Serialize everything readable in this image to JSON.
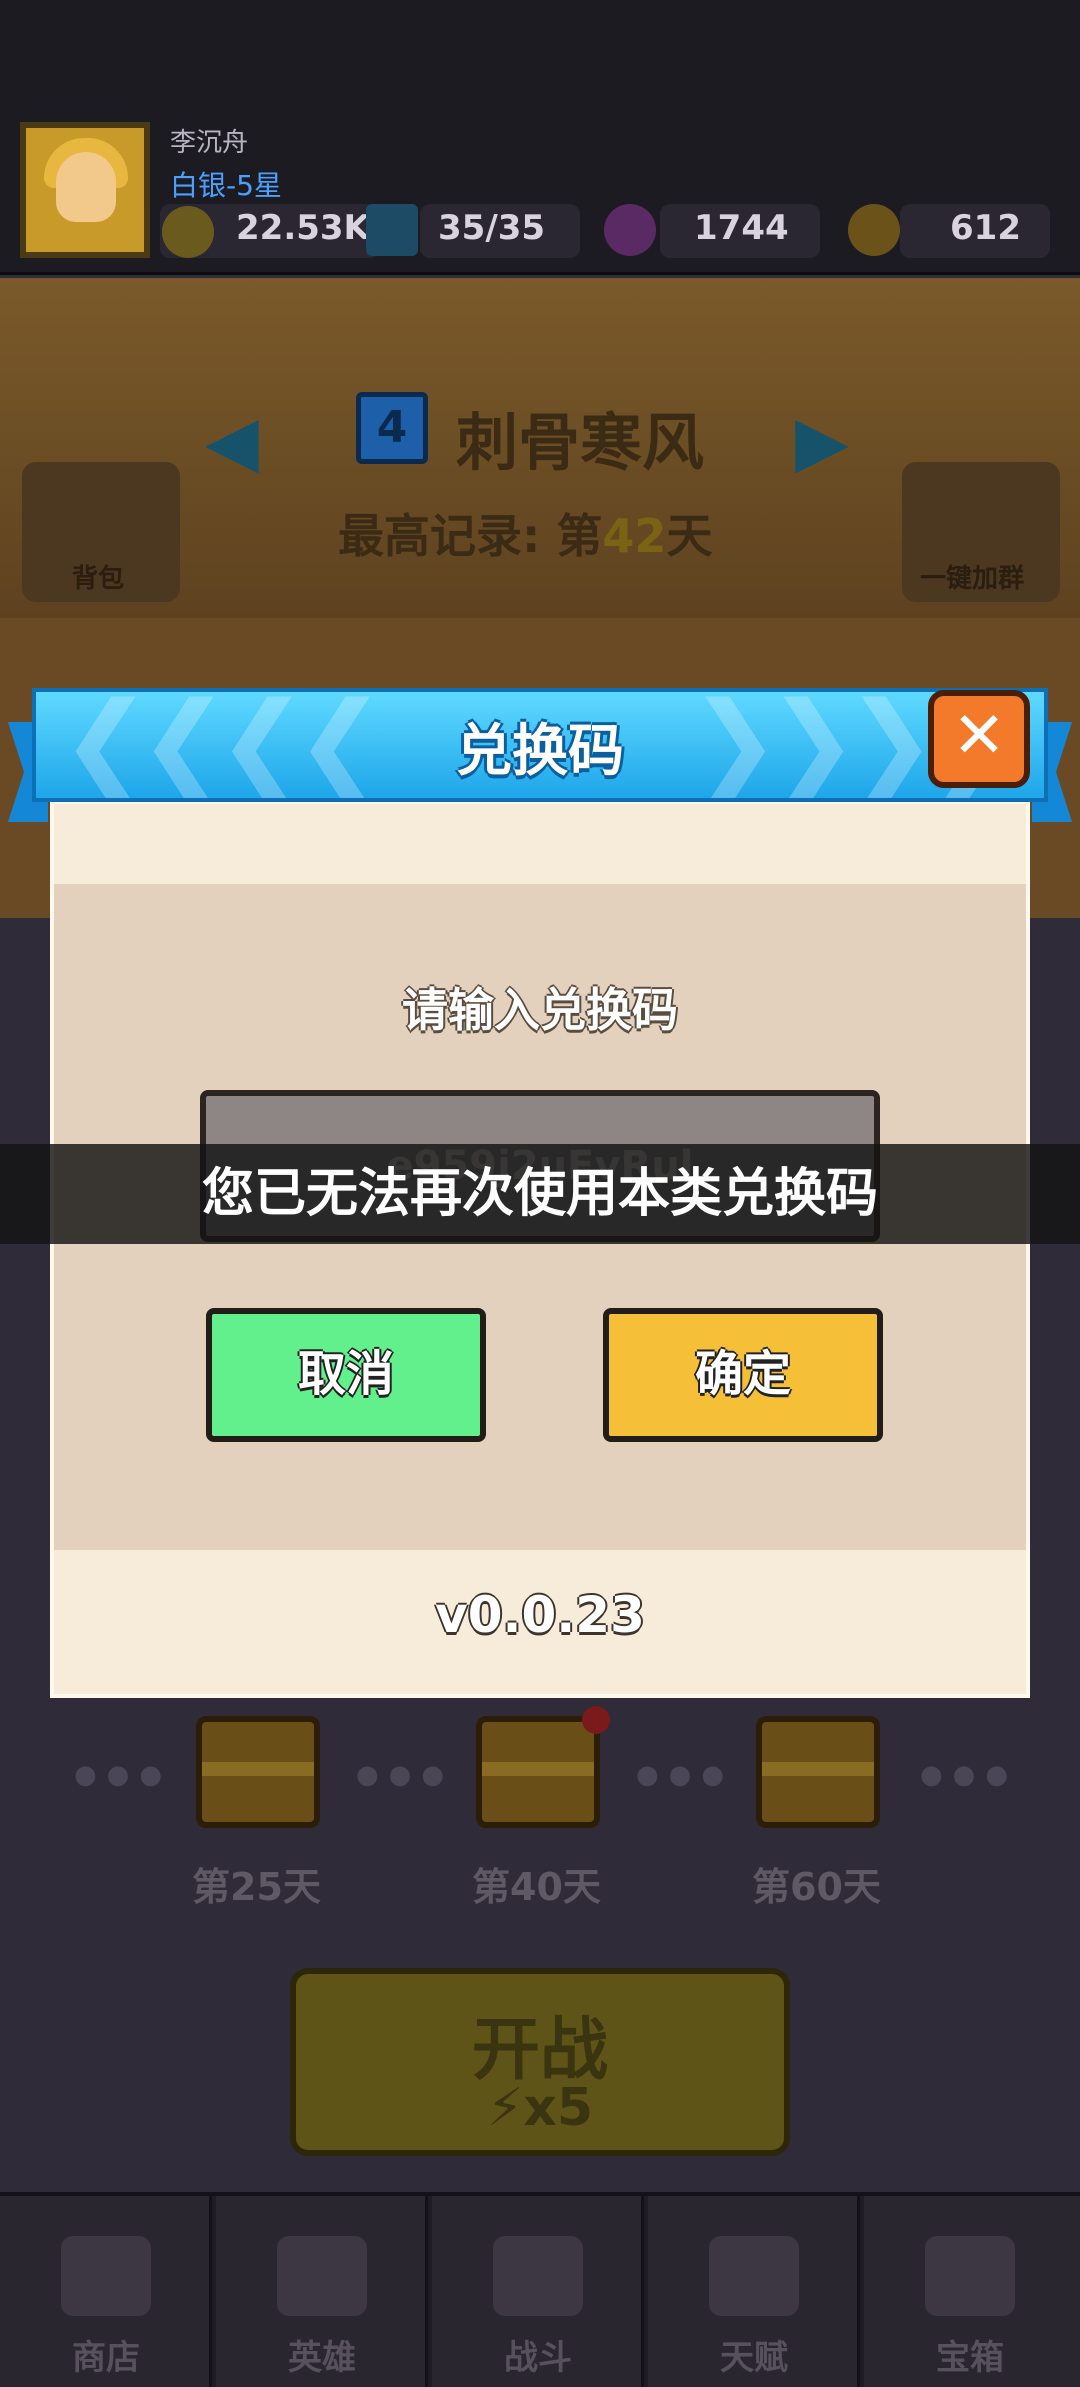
{
  "player": {
    "name": "李沉舟",
    "rank": "白银-5星",
    "power": "22.53K",
    "energy": "35/35",
    "gems": "1744",
    "coins": "612"
  },
  "stage": {
    "number": "4",
    "name": "刺骨寒风",
    "record_prefix": "最高记录: 第",
    "record_day": "42",
    "record_suffix": "天"
  },
  "side_buttons": {
    "backpack": "背包",
    "join_group": "一键加群"
  },
  "chests": [
    {
      "label": "第25天"
    },
    {
      "label": "第40天"
    },
    {
      "label": "第60天"
    }
  ],
  "battle": {
    "title": "开战",
    "cost": "x5"
  },
  "nav": [
    {
      "label": "商店"
    },
    {
      "label": "英雄"
    },
    {
      "label": "战斗"
    },
    {
      "label": "天赋"
    },
    {
      "label": "宝箱"
    }
  ],
  "dialog": {
    "title": "兑换码",
    "close_icon": "✕",
    "prompt": "请输入兑换码",
    "input_value": "e959j2uEvRul",
    "cancel_label": "取消",
    "confirm_label": "确定",
    "version": "v0.0.23"
  },
  "toast": {
    "message": "您已无法再次使用本类兑换码"
  },
  "colors": {
    "ribbon": "#1ea6ea",
    "close": "#f27a2a",
    "cancel": "#62f08c",
    "confirm": "#f6bf38"
  }
}
